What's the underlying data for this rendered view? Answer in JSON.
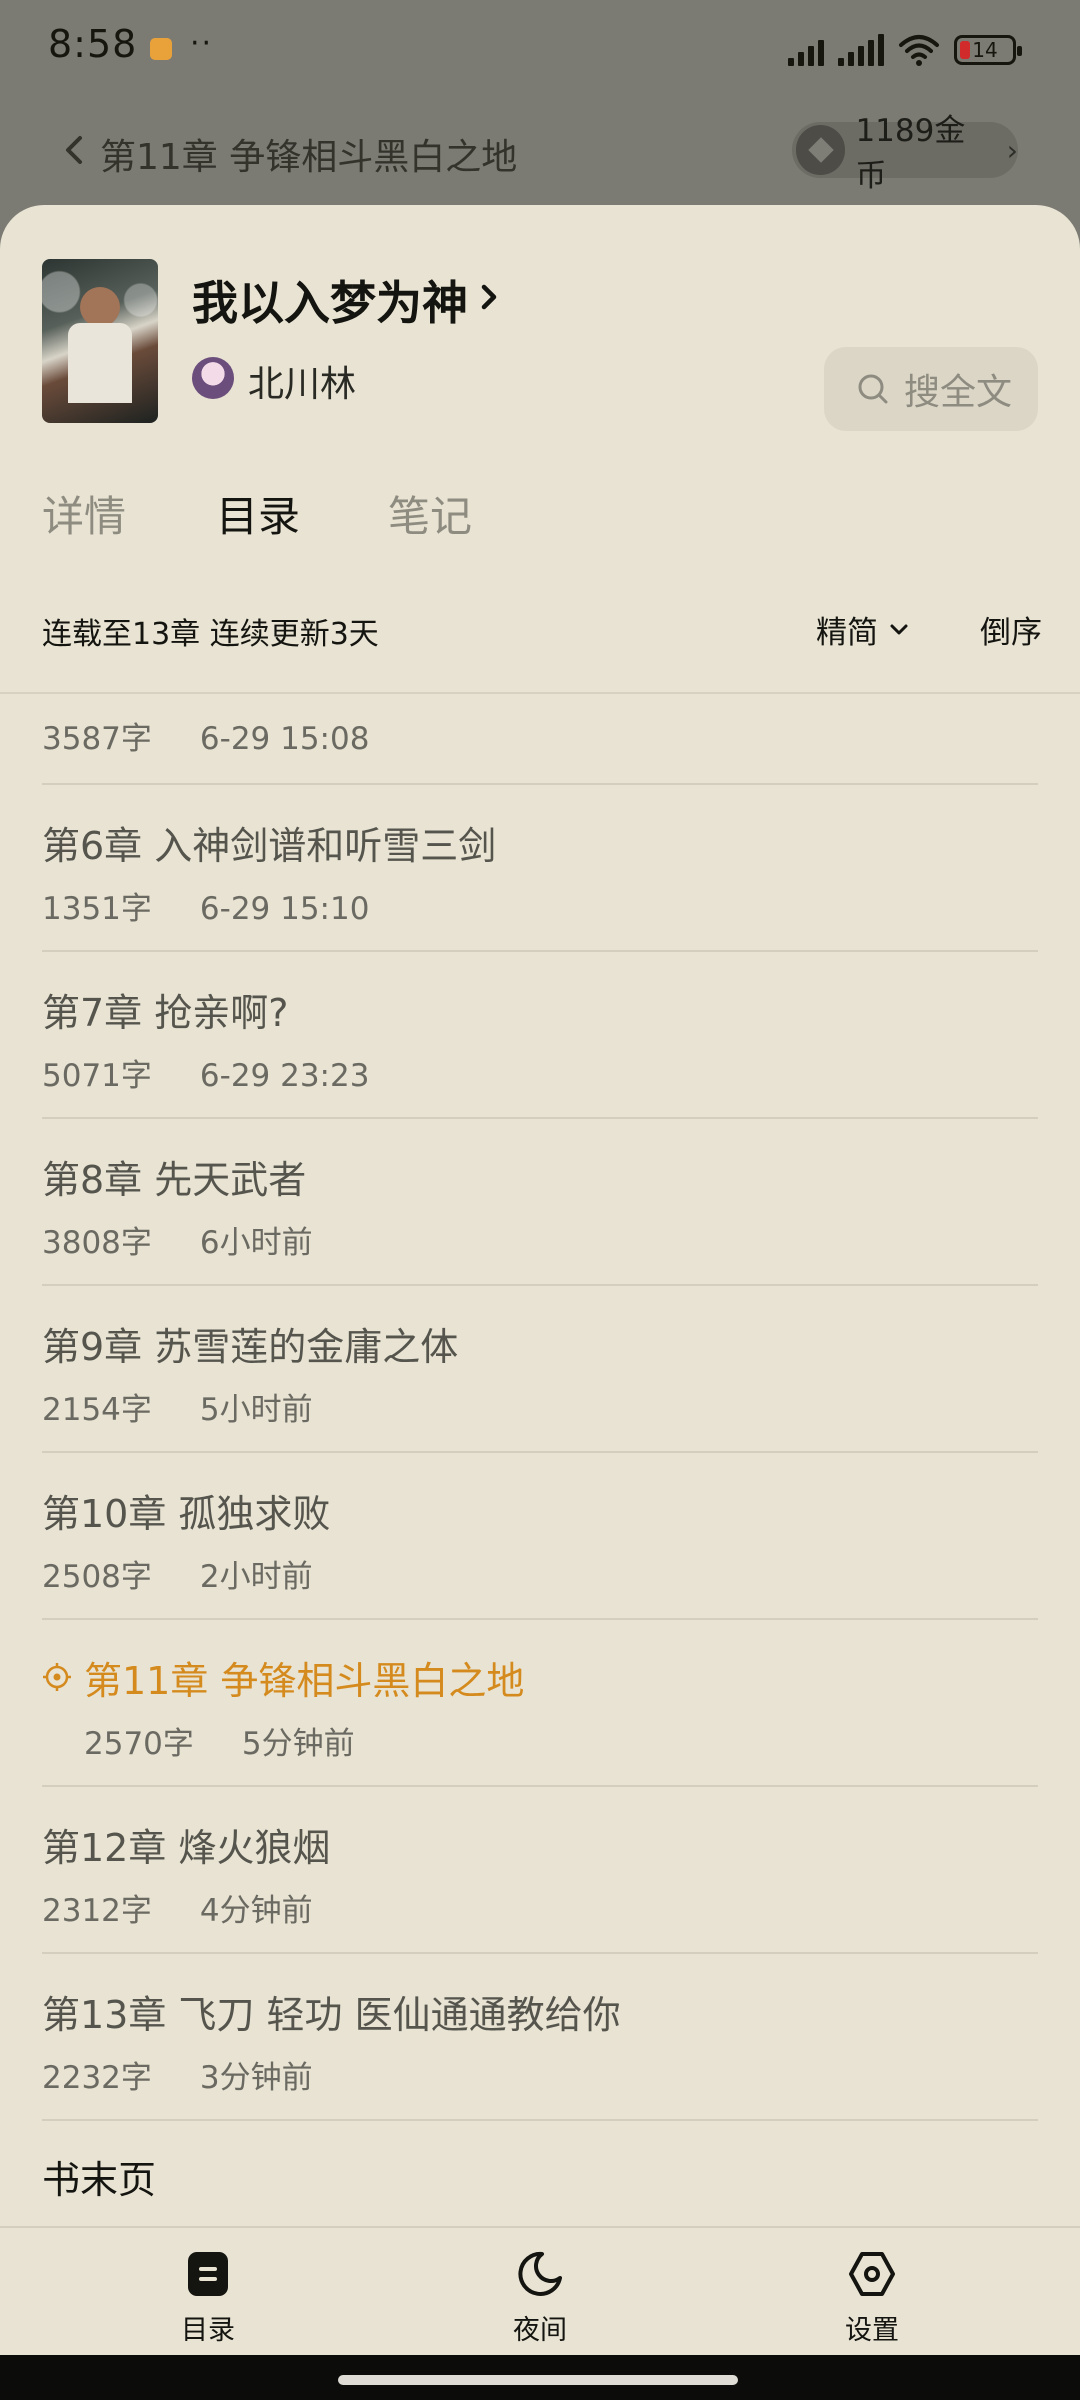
{
  "status_bar": {
    "time": "8:58",
    "notification_dots": "··",
    "battery_level": "14"
  },
  "reader": {
    "chapter_title": "第11章 争锋相斗黑白之地",
    "coins": "1189金币",
    "coin_arrow": "›"
  },
  "book": {
    "title": "我以入梦为神",
    "author": "北川林"
  },
  "search": {
    "label": "搜全文"
  },
  "tabs": [
    {
      "label": "详情"
    },
    {
      "label": "目录"
    },
    {
      "label": "笔记"
    }
  ],
  "toolbar": {
    "serial_status": "连载至13章 连续更新3天",
    "filter_label": "精简",
    "order_label": "倒序"
  },
  "chapters": [
    {
      "title": "",
      "words": "3587字",
      "time": "6-29 15:08"
    },
    {
      "title": "第6章 入神剑谱和听雪三剑",
      "words": "1351字",
      "time": "6-29 15:10"
    },
    {
      "title": "第7章 抢亲啊?",
      "words": "5071字",
      "time": "6-29 23:23"
    },
    {
      "title": "第8章 先天武者",
      "words": "3808字",
      "time": "6小时前"
    },
    {
      "title": "第9章 苏雪莲的金庸之体",
      "words": "2154字",
      "time": "5小时前"
    },
    {
      "title": "第10章 孤独求败",
      "words": "2508字",
      "time": "2小时前"
    },
    {
      "title": "第11章 争锋相斗黑白之地",
      "words": "2570字",
      "time": "5分钟前"
    },
    {
      "title": "第12章 烽火狼烟",
      "words": "2312字",
      "time": "4分钟前"
    },
    {
      "title": "第13章 飞刀 轻功 医仙通通教给你",
      "words": "2232字",
      "time": "3分钟前"
    }
  ],
  "book_end": "书末页",
  "bottom_nav": [
    {
      "label": "目录",
      "icon": "catalog-icon"
    },
    {
      "label": "夜间",
      "icon": "moon-icon"
    },
    {
      "label": "设置",
      "icon": "settings-icon"
    }
  ],
  "colors": {
    "accent": "#d58a1e",
    "sheet_bg": "#e8e3d2",
    "overlay_bg": "#7b7a73"
  }
}
